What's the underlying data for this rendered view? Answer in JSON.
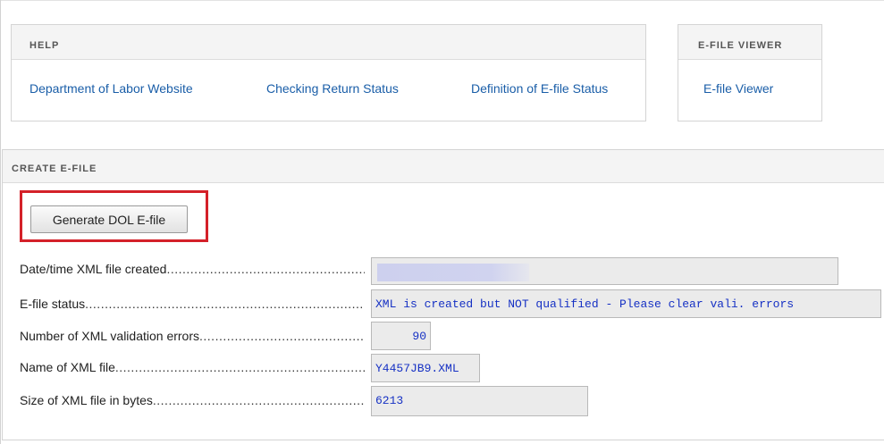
{
  "help": {
    "heading": "HELP",
    "links": [
      "Department of Labor Website",
      "Checking Return Status",
      "Definition of E-file Status"
    ]
  },
  "efile_viewer": {
    "heading": "E-FILE VIEWER",
    "link": "E-file Viewer"
  },
  "create_efile": {
    "heading": "CREATE E-FILE",
    "generate_button": "Generate DOL E-file",
    "rows": [
      {
        "label": "Date/time XML file created",
        "value": ""
      },
      {
        "label": "E-file status",
        "value": "XML is created but NOT qualified - Please clear vali. errors"
      },
      {
        "label": "Number of XML validation errors",
        "value": "90"
      },
      {
        "label": "Name of XML file",
        "value": "Y4457JB9.XML"
      },
      {
        "label": "Size of XML file in bytes",
        "value": "6213"
      }
    ]
  },
  "colors": {
    "link": "#1a5ea8",
    "field_text": "#1631c4",
    "highlight": "#d42129"
  }
}
